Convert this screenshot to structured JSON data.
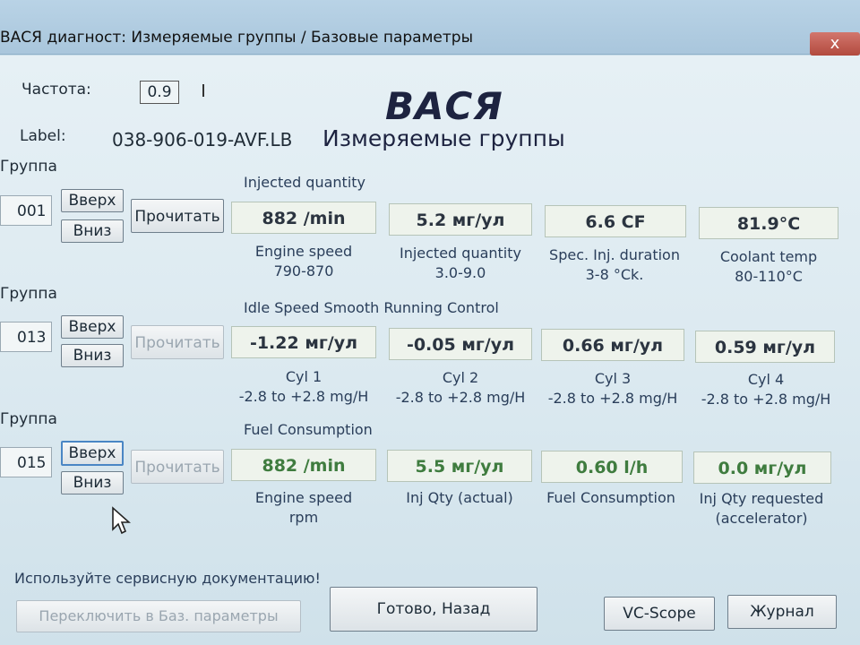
{
  "window": {
    "title": "ВАСЯ диагност: Измеряемые группы / Базовые параметры",
    "close_glyph": "x"
  },
  "header": {
    "freq_label": "Частота:",
    "freq_value": "0.9",
    "brand": "ВАСЯ",
    "label_caption": "Label:",
    "label_value": "038-906-019-AVF.LB",
    "subtitle": "Измеряемые группы"
  },
  "groups": [
    {
      "group_label": "Группа",
      "number": "001",
      "up": "Вверх",
      "down": "Вниз",
      "read": "Прочитать",
      "title": "Injected quantity",
      "fields": [
        {
          "value": "882 /min",
          "name": "Engine speed",
          "spec": "790-870"
        },
        {
          "value": "5.2 мг/ул",
          "name": "Injected quantity",
          "spec": "3.0-9.0"
        },
        {
          "value": "6.6 CF",
          "name": "Spec. Inj. duration",
          "spec": "3-8 °Ck."
        },
        {
          "value": "81.9°C",
          "name": "Coolant temp",
          "spec": "80-110°C"
        }
      ]
    },
    {
      "group_label": "Группа",
      "number": "013",
      "up": "Вверх",
      "down": "Вниз",
      "read": "Прочитать",
      "title": "Idle Speed Smooth Running Control",
      "fields": [
        {
          "value": "-1.22 мг/ул",
          "name": "Cyl 1",
          "spec": "-2.8 to +2.8 mg/H"
        },
        {
          "value": "-0.05 мг/ул",
          "name": "Cyl 2",
          "spec": "-2.8 to +2.8 mg/H"
        },
        {
          "value": "0.66 мг/ул",
          "name": "Cyl 3",
          "spec": "-2.8 to +2.8 mg/H"
        },
        {
          "value": "0.59 мг/ул",
          "name": "Cyl 4",
          "spec": "-2.8 to +2.8 mg/H"
        }
      ]
    },
    {
      "group_label": "Группа",
      "number": "015",
      "up": "Вверх",
      "down": "Вниз",
      "read": "Прочитать",
      "title": "Fuel Consumption",
      "fields": [
        {
          "value": "882 /min",
          "name": "Engine speed",
          "spec": "rpm"
        },
        {
          "value": "5.5 мг/ул",
          "name": "Inj Qty (actual)",
          "spec": ""
        },
        {
          "value": "0.60 l/h",
          "name": "Fuel Consumption",
          "spec": ""
        },
        {
          "value": "0.0 мг/ул",
          "name": "Inj Qty requested",
          "spec": "(accelerator)"
        }
      ]
    }
  ],
  "footer": {
    "hint": "Используйте сервисную документацию!",
    "switch_button": "Переключить в Баз. параметры",
    "done_button": "Готово, Назад",
    "scope_button": "VC-Scope",
    "log_button": "Журнал"
  },
  "colors": {
    "group3_value_text": "#3f7c3f",
    "brand_text": "#1d2340"
  }
}
